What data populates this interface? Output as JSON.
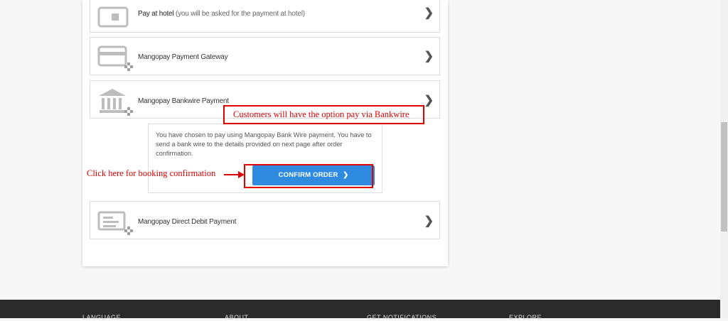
{
  "payment_methods": [
    {
      "label": "Pay at hotel",
      "note": " (you will be asked for the payment at hotel)",
      "icon": "wallet-icon"
    },
    {
      "label": "Mangopay Payment Gateway",
      "icon": "credit-card-icon"
    },
    {
      "label": "Mangopay Bankwire Payment",
      "icon": "bank-icon"
    },
    {
      "label": "Mangopay Direct Debit Payment",
      "icon": "direct-debit-icon"
    }
  ],
  "bankwire_info": "You have chosen to pay using Mangopay Bank Wire payment. You have to send a bank wire to the details provided on next page after order confirmation.",
  "confirm_label": "CONFIRM ORDER",
  "annotations": {
    "bankwire_option": "Customers will have the option  pay via Bankwire",
    "confirm_hint": "Click here for booking confirmation"
  },
  "footer": [
    "LANGUAGE",
    "ABOUT",
    "GET NOTIFICATIONS",
    "EXPLORE"
  ],
  "colors": {
    "accent": "#2f8be0",
    "annotation_red": "#e00000",
    "footer_bg": "#2b2b2b"
  }
}
